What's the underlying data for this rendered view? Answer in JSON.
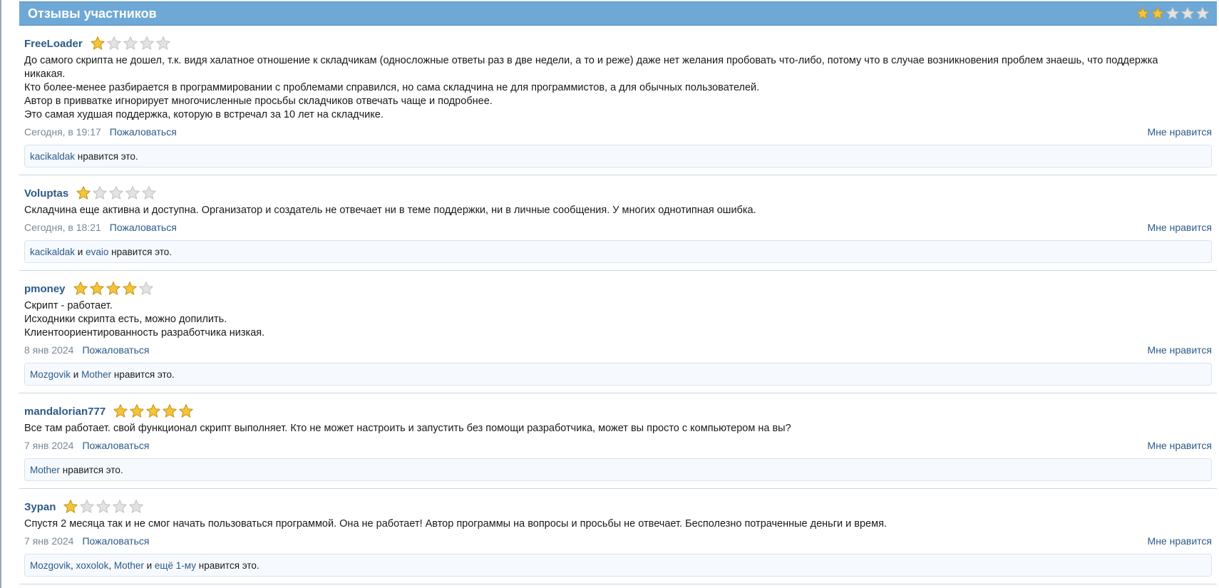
{
  "panel": {
    "title": "Отзывы участников",
    "overall_rating": 2
  },
  "reviews": [
    {
      "author": "FreeLoader",
      "rating": 1,
      "lines": [
        "До самого скрипта не дошел, т.к. видя халатное отношение к складчикам (односложные ответы раз в две недели, а то и реже) даже нет желания пробовать что-либо, потому что в случае возникновения проблем знаешь, что поддержка",
        "никакая.",
        "Кто более-менее разбирается в программировании с проблемами справился, но сама складчина не для программистов, а для обычных пользователей.",
        "Автор в привватке игнорирует многочисленные просьбы складчиков отвечать чаще и подробнее.",
        "Это самая худшая поддержка, которую в встречал за 10 лет на складчике."
      ],
      "date": "Сегодня, в 19:17",
      "report": "Пожаловаться",
      "like": "Мне нравится",
      "likes": {
        "users": [
          "kacikaldak"
        ],
        "separators": [],
        "suffix": " нравится это."
      }
    },
    {
      "author": "Voluptas",
      "rating": 1,
      "lines": [
        "Складчина еще активна и доступна. Организатор и создатель не отвечает ни в теме поддержки, ни в личные сообщения. У многих однотипная ошибка."
      ],
      "date": "Сегодня, в 18:21",
      "report": "Пожаловаться",
      "like": "Мне нравится",
      "likes": {
        "users": [
          "kacikaldak",
          "evaio"
        ],
        "separators": [
          " и "
        ],
        "suffix": " нравится это."
      }
    },
    {
      "author": "pmoney",
      "rating": 4,
      "lines": [
        "Скрипт - работает.",
        "Исходники скрипта есть, можно допилить.",
        "Клиентоориентированность разработчика низкая."
      ],
      "date": "8 янв 2024",
      "report": "Пожаловаться",
      "like": "Мне нравится",
      "likes": {
        "users": [
          "Mozgovik",
          "Mother"
        ],
        "separators": [
          " и "
        ],
        "suffix": " нравится это."
      }
    },
    {
      "author": "mandalorian777",
      "rating": 5,
      "lines": [
        "Все там работает. свой функционал скрипт выполняет. Кто не может настроить и запустить без помощи разработчика, может вы просто с компьютером на вы?"
      ],
      "date": "7 янв 2024",
      "report": "Пожаловаться",
      "like": "Мне нравится",
      "likes": {
        "users": [
          "Mother"
        ],
        "separators": [],
        "suffix": " нравится это."
      }
    },
    {
      "author": "Зуpan",
      "rating": 1,
      "lines": [
        "Спустя 2 месяца так и не смог начать пользоваться программой. Она не работает! Автор программы на вопросы и просьбы не отвечает. Бесполезно потраченные деньги и время."
      ],
      "date": "7 янв 2024",
      "report": "Пожаловаться",
      "like": "Мне нравится",
      "likes": {
        "users": [
          "Mozgovik",
          "xoxolok",
          "Mother",
          "ещё 1-му"
        ],
        "separators": [
          ", ",
          ", ",
          " и "
        ],
        "suffix": " нравится это."
      }
    }
  ],
  "colors": {
    "header_bg": "#6ea8d6",
    "link": "#2c5a8a",
    "star_filled": "#f3c53a",
    "star_empty": "#e3e3e3"
  }
}
